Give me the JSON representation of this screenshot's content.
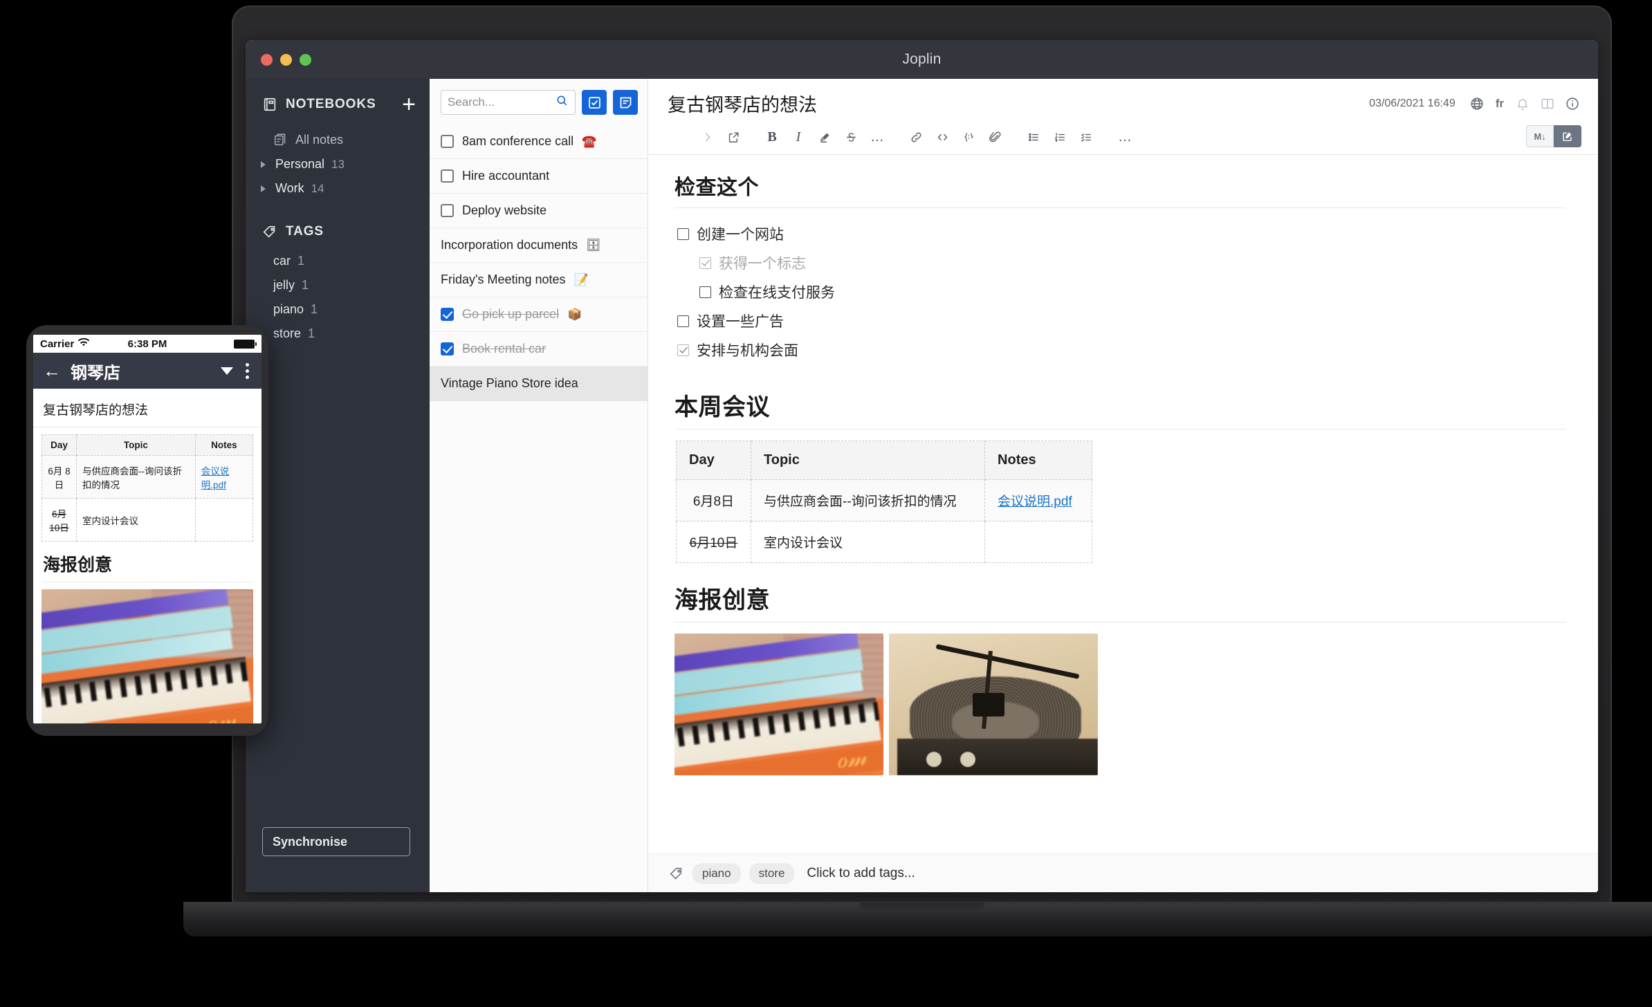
{
  "window": {
    "title": "Joplin",
    "traffic_lights": [
      "close",
      "minimize",
      "zoom"
    ]
  },
  "sidebar": {
    "notebooks_header": "NOTEBOOKS",
    "add_label": "+",
    "all_notes": "All notes",
    "notebooks": [
      {
        "label": "Personal",
        "count": "13"
      },
      {
        "label": "Work",
        "count": "14"
      }
    ],
    "tags_header": "TAGS",
    "tags": [
      {
        "label": "car",
        "count": "1"
      },
      {
        "label": "jelly",
        "count": "1"
      },
      {
        "label": "piano",
        "count": "1"
      },
      {
        "label": "store",
        "count": "1"
      }
    ],
    "sync_button": "Synchronise"
  },
  "notelist": {
    "search_placeholder": "Search...",
    "new_todo_label": "New to-do",
    "new_note_label": "New note",
    "items": [
      {
        "title": "8am conference call",
        "emoji": "☎️",
        "checkbox": true,
        "checked": false,
        "done": false,
        "selected": false
      },
      {
        "title": "Hire accountant",
        "emoji": "",
        "checkbox": true,
        "checked": false,
        "done": false,
        "selected": false
      },
      {
        "title": "Deploy website",
        "emoji": "",
        "checkbox": true,
        "checked": false,
        "done": false,
        "selected": false
      },
      {
        "title": "Incorporation documents",
        "emoji": "🗄",
        "checkbox": false,
        "checked": false,
        "done": false,
        "selected": false
      },
      {
        "title": "Friday's Meeting notes",
        "emoji": "📝",
        "checkbox": false,
        "checked": false,
        "done": false,
        "selected": false
      },
      {
        "title": "Go pick up parcel",
        "emoji": "📦",
        "checkbox": true,
        "checked": true,
        "done": true,
        "selected": false
      },
      {
        "title": "Book rental car",
        "emoji": "",
        "checkbox": true,
        "checked": true,
        "done": true,
        "selected": false
      },
      {
        "title": "Vintage Piano Store idea",
        "emoji": "",
        "checkbox": false,
        "checked": false,
        "done": false,
        "selected": true
      }
    ]
  },
  "editor": {
    "note_title": "复古钢琴店的想法",
    "updated_at": "03/06/2021 16:49",
    "language_code": "fr",
    "toolbar": {
      "back": "back",
      "forward": "forward",
      "external_edit": "external-edit",
      "bold": "B",
      "italic": "I",
      "highlight": "highlight",
      "strikethrough": "S",
      "more_format": "…",
      "link": "link",
      "code": "code",
      "code_block": "code-block",
      "attach": "attach",
      "bullet_list": "bullet-list",
      "numbered_list": "numbered-list",
      "checkbox_list": "checkbox-list",
      "more": "…",
      "markdown_mode": "M↓",
      "rich_text_mode": "rich-text"
    },
    "sections": {
      "check_this": "检查这个",
      "meetings": "本周会议",
      "poster_ideas": "海报创意"
    },
    "checklist": [
      {
        "label": "创建一个网站",
        "checked": false,
        "indent": 0,
        "muted": false
      },
      {
        "label": "获得一个标志",
        "checked": true,
        "indent": 1,
        "muted": true
      },
      {
        "label": "检查在线支付服务",
        "checked": false,
        "indent": 1,
        "muted": false
      },
      {
        "label": "设置一些广告",
        "checked": false,
        "indent": 0,
        "muted": false
      },
      {
        "label": "安排与机构会面",
        "checked": true,
        "indent": 0,
        "muted": false
      }
    ],
    "table": {
      "headers": [
        "Day",
        "Topic",
        "Notes"
      ],
      "rows": [
        {
          "day": "6月8日",
          "day_strike": false,
          "topic": "与供应商会面--询问该折扣的情况",
          "note_link": "会议说明.pdf"
        },
        {
          "day": "6月10日",
          "day_strike": true,
          "topic": "室内设计会议",
          "note_link": ""
        }
      ]
    },
    "images": [
      {
        "alt": "orange vintage piano keyboard"
      },
      {
        "alt": "sepia record player turntable"
      }
    ],
    "tagbar": {
      "tags": [
        "piano",
        "store"
      ],
      "add_hint": "Click to add tags..."
    }
  },
  "phone": {
    "status": {
      "carrier": "Carrier",
      "time": "6:38 PM"
    },
    "navbar": {
      "back": "←",
      "title": "钢琴店"
    },
    "note_title": "复古钢琴店的想法",
    "table": {
      "headers": [
        "Day",
        "Topic",
        "Notes"
      ],
      "rows": [
        {
          "day": "6月 8日",
          "day_strike": false,
          "topic": "与供应商会面--询问该折扣的情况",
          "note_link": "会议说明.pdf"
        },
        {
          "day": "6月 10日",
          "day_strike": true,
          "topic": "室内设计会议",
          "note_link": ""
        }
      ]
    },
    "section_poster": "海报创意"
  }
}
